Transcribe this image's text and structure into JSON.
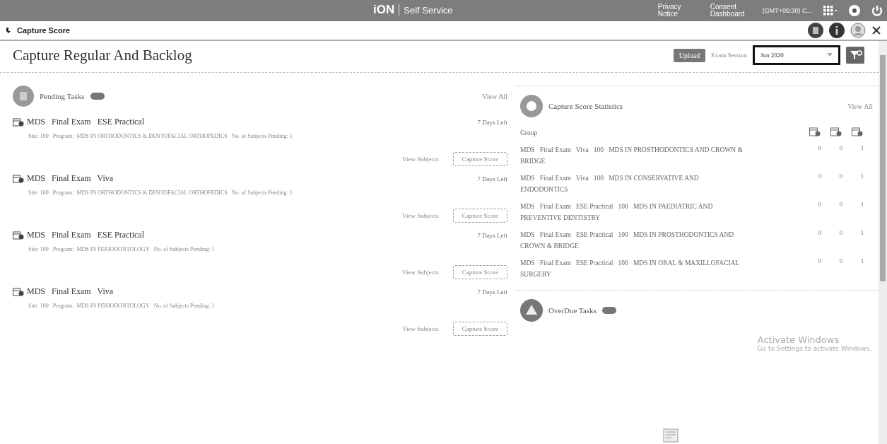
{
  "header": {
    "brand": "iON",
    "product": "Self Service",
    "links": [
      "Privacy Notice",
      "Consent Dashboard"
    ],
    "timezone": "(GMT+05:30) C..."
  },
  "breadcrumb": {
    "title": "Capture Score"
  },
  "page": {
    "title": "Capture Regular And Backlog",
    "upload_label": "Upload",
    "exam_session_label": "Exam Session",
    "exam_session_value": "Jun 2020"
  },
  "pending": {
    "title": "Pending Tasks",
    "view_all": "View All",
    "tasks": [
      {
        "course": "MDS",
        "exam": "Final Exam",
        "type": "ESE Practical",
        "days_left": "7 Days Left",
        "site_label": "Site:",
        "site": "100",
        "program_label": "Program:",
        "program": "MDS IN ORTHODONTICS & DENTOFACIAL ORTHOPEDICS",
        "pending_label": "No. of Subjects Pending:",
        "pending": "1",
        "view_subjects": "View Subjects",
        "capture": "Capture Score"
      },
      {
        "course": "MDS",
        "exam": "Final Exam",
        "type": "Viva",
        "days_left": "7 Days Left",
        "site_label": "Site:",
        "site": "100",
        "program_label": "Program:",
        "program": "MDS IN ORTHODONTICS & DENTOFACIAL ORTHOPEDICS",
        "pending_label": "No. of Subjects Pending:",
        "pending": "1",
        "view_subjects": "View Subjects",
        "capture": "Capture Score"
      },
      {
        "course": "MDS",
        "exam": "Final Exam",
        "type": "ESE Practical",
        "days_left": "7 Days Left",
        "site_label": "Site:",
        "site": "100",
        "program_label": "Program:",
        "program": "MDS IN PERIODONTOLOGY",
        "pending_label": "No. of Subjects Pending:",
        "pending": "1",
        "view_subjects": "View Subjects",
        "capture": "Capture Score"
      },
      {
        "course": "MDS",
        "exam": "Final Exam",
        "type": "Viva",
        "days_left": "7 Days Left",
        "site_label": "Site:",
        "site": "100",
        "program_label": "Program:",
        "program": "MDS IN PERIODONTOLOGY",
        "pending_label": "No. of Subjects Pending:",
        "pending": "1",
        "view_subjects": "View Subjects",
        "capture": "Capture Score"
      }
    ]
  },
  "statistics": {
    "title": "Capture Score Statistics",
    "view_all": "View All",
    "group_header": "Group",
    "rows": [
      {
        "group": "MDS   Final Exam   Viva   100   MDS IN PROSTHODONTICS AND CROWN & BRIDGE",
        "counts": [
          "0",
          "0",
          "1"
        ]
      },
      {
        "group": "MDS   Final Exam   Viva   100   MDS IN CONSERVATIVE AND ENDODONTICS",
        "counts": [
          "0",
          "0",
          "1"
        ]
      },
      {
        "group": "MDS   Final Exam   ESE Practical   100   MDS IN PAEDIATRIC AND PREVENTIVE DENTISTRY",
        "counts": [
          "0",
          "0",
          "1"
        ]
      },
      {
        "group": "MDS   Final Exam   ESE Practical   100   MDS IN PROSTHODONTICS AND CROWN & BRIDGE",
        "counts": [
          "0",
          "0",
          "1"
        ]
      },
      {
        "group": "MDS   Final Exam   ESE Practical   100   MDS IN ORAL & MAXILLOFACIAL SURGERY",
        "counts": [
          "0",
          "0",
          "1"
        ]
      }
    ]
  },
  "overdue": {
    "title": "OverDue Tasks"
  },
  "activation": {
    "title": "Activate Windows",
    "message": "Go to Settings to activate Windows."
  }
}
